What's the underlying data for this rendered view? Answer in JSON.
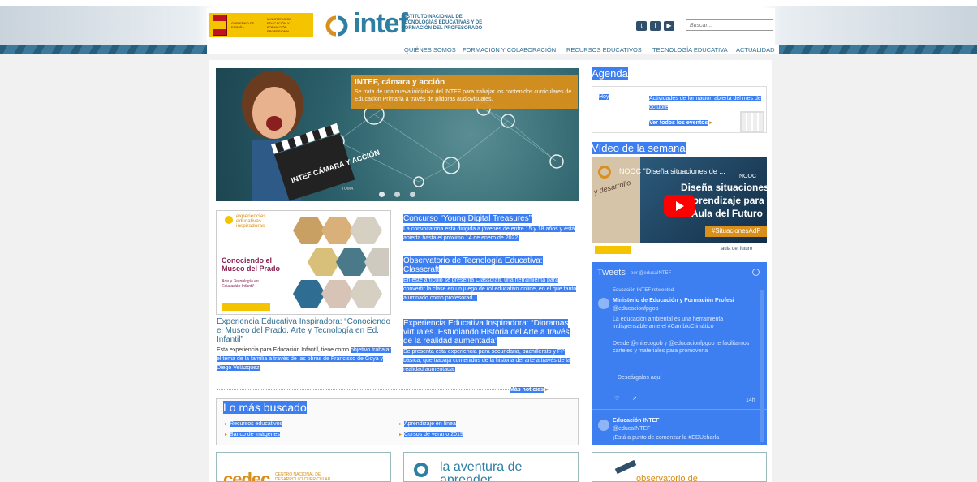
{
  "header": {
    "gov_text_1": "GOBIERNO DE ESPAÑA",
    "gov_text_2": "MINISTERIO DE EDUCACIÓN Y FORMACIÓN PROFESIONAL",
    "brand": "intef",
    "brand_desc": "INSTITUTO NACIONAL DE TECNOLOGÍAS EDUCATIVAS Y DE FORMACIÓN DEL PROFESORADO",
    "search_placeholder": "Buscar..."
  },
  "nav": {
    "items": [
      "QUIÉNES SOMOS",
      "FORMACIÓN Y COLABORACIÓN",
      "RECURSOS EDUCATIVOS",
      "TECNOLOGÍA EDUCATIVA",
      "ACTUALIDAD"
    ]
  },
  "hero": {
    "title": "INTEF, cámara y acción",
    "text": "Se trata de una nueva iniciativa del INTEF para trabajar los contenidos curriculares de Educación Primaria a través de píldoras audiovisuales.",
    "clapper_text": "INTEF CÁMARA Y ACCIÓN",
    "clapper_small": "TOMA"
  },
  "experience": {
    "img_label_1": "experiencias educativas inspiradoras",
    "img_title": "Conociendo el Museo del Prado",
    "img_sub": "Arte y Tecnología en Educación Infantil",
    "title": "Experiencia Educativa Inspiradora: “Conociendo el Museo del Prado. Arte y Tecnología en Ed. Infantil”",
    "text_a": "Esta experiencia para Educación Infantil, tiene como",
    "text_b": "objetivo trabajar el tema de la familia a través de las obras de Francisco de Goya y Diego Velázquez."
  },
  "news": [
    {
      "title": "Concurso “Young Digital Treasures”",
      "text": "La convocatoria está dirigida a jóvenes de entre 15 y 18 años y está abierta hasta el próximo 14 de enero de 2022."
    },
    {
      "title": "Observatorio de Tecnología Educativa: Classcraft",
      "text": "En este artículo se presenta Classcraft, una herramienta para convertir la clase en un juego de rol educativo online, en el que tanto alumnado como profesorad..."
    },
    {
      "title": "Experiencia Educativa Inspiradora: “Dioramas virtuales. Estudiando Historia del Arte a través de la realidad aumentada”",
      "text": "Se presenta esta experiencia para secundaria, bachillerato y FP básica, que trabaja contenidos de la historia del arte a través de la realidad aumentada."
    }
  ],
  "more_news": "Más noticias",
  "buscado": {
    "title": "Lo más buscado",
    "links": [
      "Recursos educativos",
      "Banco de imágenes",
      "Aprendizaje en línea",
      "Cursos de verano 2019"
    ]
  },
  "bottom": {
    "cedec": "cedec",
    "cedec_desc": "CENTRO NACIONAL DE DESARROLLO CURRICULAR",
    "aventura": "la aventura de aprender",
    "observatorio": "observatorio de"
  },
  "agenda": {
    "heading": "Agenda",
    "day": "Hoy",
    "event": "Actividades de formación abierta del mes de octubre",
    "all_link": "Ver todos los eventos"
  },
  "video": {
    "heading": "Vídeo de la semana",
    "title": "NOOC \"Diseña situaciones de ...",
    "overlay_1": "Diseña situaciones",
    "overlay_2": "aprendizaje para",
    "overlay_3": "el Aula del Futuro",
    "hashtag": "#SituacionesAdF",
    "nooc": "NOOC",
    "aula": "aula del futuro",
    "bg_text": "y desarrollo"
  },
  "tweets": {
    "heading": "Tweets",
    "by": "por @educaINTEF",
    "retweet": "Educación INTEF retweeted",
    "t1_name": "Ministerio de Educación y Formación Profesi",
    "t1_handle": "@educacionfpgob",
    "t1_text": "La educación ambiental es una herramienta indispensable ante el #CambioClimático",
    "t1_text2": "Desde @mitecogob y @educacionfpgob te facilitamos carteles y materiales para promoverla",
    "t1_link": "Descárgalos aquí",
    "t1_time": "14h",
    "t2_name": "Educación INTEF",
    "t2_handle": "@educaINTEF",
    "t2_text": "¡Está a punto de comenzar la #EDUcharla"
  }
}
